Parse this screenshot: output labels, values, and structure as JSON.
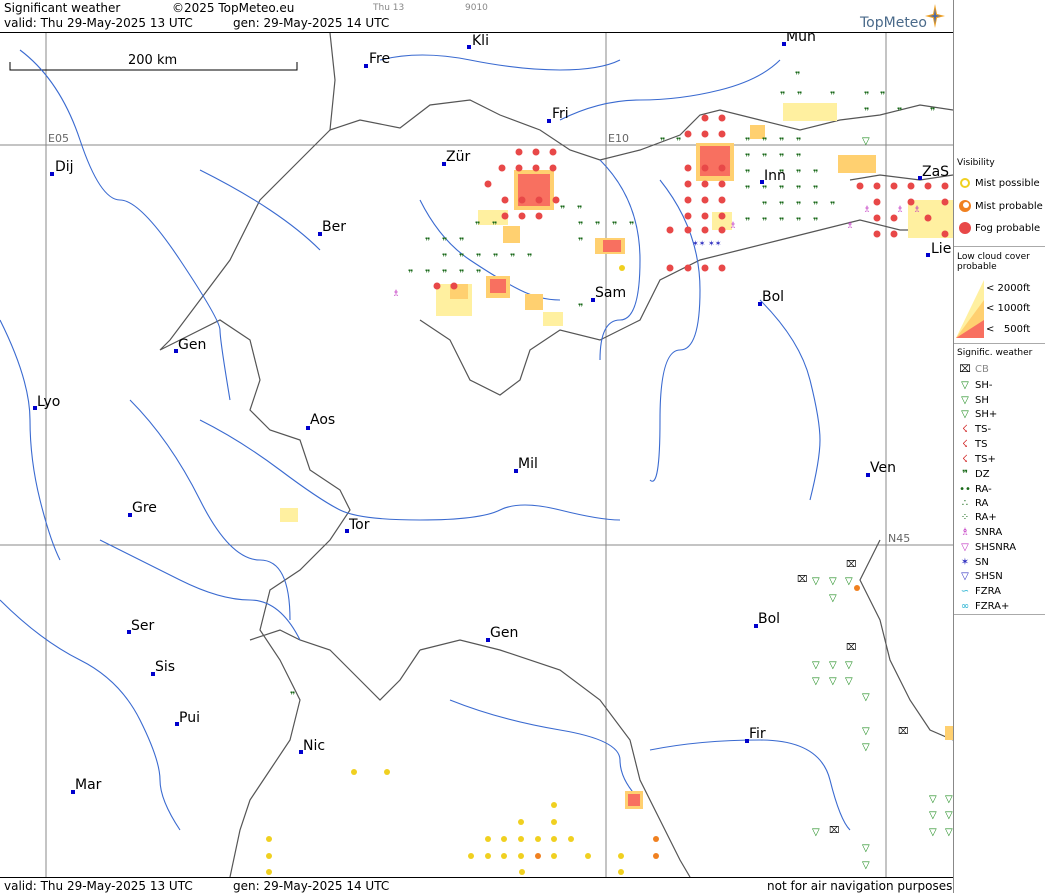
{
  "header": {
    "title": "Significant weather",
    "copyright": "©2025 TopMeteo.eu",
    "thu_label": "Thu 13",
    "code": "9010",
    "valid": "valid:  Thu  29-May-2025  13 UTC",
    "generated": "gen: 29-May-2025 14 UTC",
    "logo": "TopMeteo"
  },
  "footer": {
    "valid": "valid:  Thu  29-May-2025  13 UTC",
    "generated": "gen: 29-May-2025 14 UTC",
    "disclaimer": "not for air navigation purposes"
  },
  "map": {
    "scale_label": "200 km",
    "grid_labels": {
      "e05": "E05",
      "e10": "E10",
      "n45": "N45"
    },
    "cities": [
      "Kli",
      "Fre",
      "Mun",
      "Fri",
      "Dij",
      "Zür",
      "Inn",
      "ZaS",
      "Ber",
      "Lie",
      "Sam",
      "Bol",
      "Gen",
      "Lyo",
      "Aos",
      "Mil",
      "Ven",
      "Gre",
      "Tor",
      "Bol",
      "Ser",
      "Gen",
      "Sis",
      "Pui",
      "Nic",
      "Fir",
      "Mar"
    ]
  },
  "legend": {
    "visibility": {
      "title": "Visibility",
      "items": [
        "Mist possible",
        "Mist probable",
        "Fog probable"
      ]
    },
    "low_cloud": {
      "title": "Low cloud cover probable",
      "items": [
        "< 2000ft",
        "< 1000ft",
        "<   500ft"
      ]
    },
    "signif": {
      "title": "Signific. weather",
      "items": [
        "CB",
        "SH-",
        "SH",
        "SH+",
        "TS-",
        "TS",
        "TS+",
        "DZ",
        "RA-",
        "RA",
        "RA+",
        "SNRA",
        "SHSNRA",
        "SN",
        "SHSN",
        "FZRA",
        "FZRA+"
      ]
    }
  },
  "colors": {
    "fog": "#e84848",
    "mist_probable": "#f08020",
    "mist_possible": "#f0d020",
    "low_cloud_2000": "#fff5b0",
    "low_cloud_1000": "#ffd070",
    "low_cloud_500": "#f87060",
    "drizzle": "#1a6a1a",
    "city_marker": "#0000cc"
  }
}
